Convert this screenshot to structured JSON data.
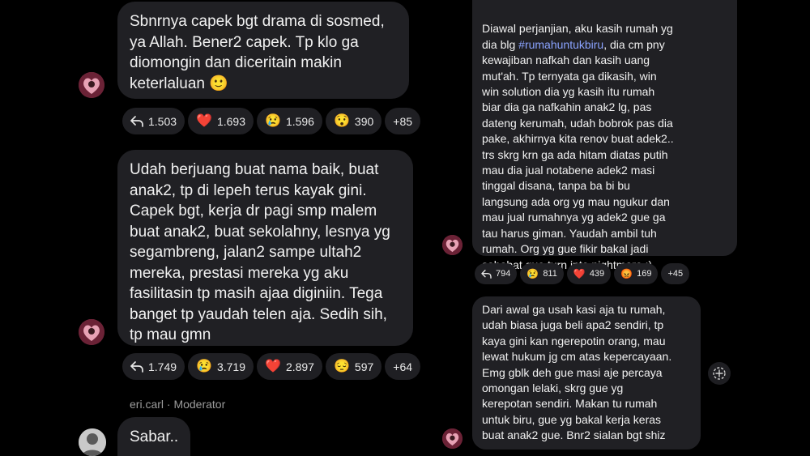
{
  "left_thread": {
    "msg1": {
      "text": "Sbnrnya capek bgt drama di sosmed,\nya Allah. Bener2 capek. Tp klo ga\ndiomongin dan diceritain makin\nketerlaluan 🙂"
    },
    "reactions1": {
      "replies": "1.503",
      "heart": "1.693",
      "cry": "1.596",
      "wow": "390",
      "more": "+85"
    },
    "msg2": {
      "text": "Udah berjuang buat nama baik, buat\nanak2, tp di lepeh terus kayak gini.\nCapek bgt, kerja dr pagi smp malem\nbuat anak2, buat sekolahny, lesnya yg\nsegambreng, jalan2 sampe ultah2\nmereka, prestasi mereka yg aku\nfasilitasin tp masih ajaa diginiin. Tega\nbanget tp yaudah telen aja. Sedih sih,\ntp mau gmn"
    },
    "reactions2": {
      "replies": "1.749",
      "cry": "3.719",
      "heart": "2.897",
      "sad": "597",
      "more": "+64"
    },
    "moderator_line": "eri.carl · Moderator",
    "msg3": {
      "text": "Sabar.."
    }
  },
  "right_thread": {
    "msg1": {
      "text_before": "Diawal perjanjian, aku kasih rumah yg\ndia blg ",
      "hashtag": "#rumahuntukbiru",
      "text_after": ", dia cm pny\nkewajiban nafkah dan kasih uang\nmut'ah. Tp ternyata ga dikasih, win\nwin solution dia yg kasih itu rumah\nbiar dia ga nafkahin anak2 lg, pas\ndateng kerumah, udah bobrok pas dia\npake, akhirnya kita renov buat adek2..\ntrs skrg krn ga ada hitam diatas putih\nmau dia jual notabene adek2 masi\ntinggal disana, tanpa ba bi bu\nlangsung ada org yg mau ngukur dan\nmau jual rumahnya yg adek2 gue ga\ntau harus giman. Yaudah ambil tuh\nrumah. Org yg gue fikir bakal jadi\nsahabat gue turn into nightmare :)"
    },
    "reactions1": {
      "replies": "794",
      "cry": "811",
      "heart": "439",
      "angry": "169",
      "more": "+45"
    },
    "msg2": {
      "text": "Dari awal ga usah kasi aja tu rumah,\nudah biasa juga beli apa2 sendiri, tp\nkaya gini kan ngerepotin orang, mau\nlewat hukum jg cm atas kepercayaan.\nEmg gblk deh gue masi aje percaya\nomongan lelaki, skrg gue yg\nkerepotan sendiri. Makan tu rumah\nuntuk biru, gue yg bakal kerja keras\nbuat anak2 gue. Bnr2 sialan bgt shiz"
    }
  },
  "emojis": {
    "heart": "❤️",
    "cry": "😢",
    "wow": "😯",
    "sad": "😔",
    "angry": "😡"
  },
  "icons": [
    "reply-icon",
    "avatar-icon",
    "add-reaction-icon"
  ]
}
